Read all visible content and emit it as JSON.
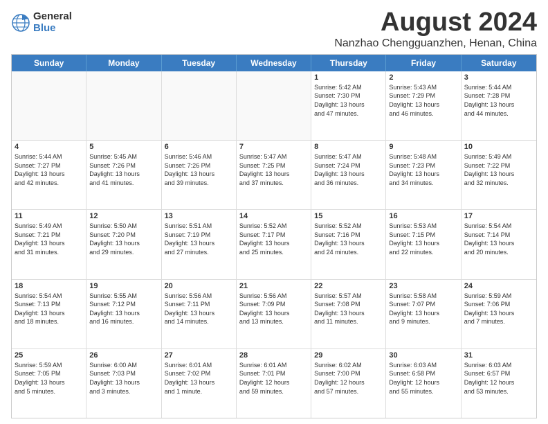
{
  "logo": {
    "general": "General",
    "blue": "Blue"
  },
  "title": "August 2024",
  "location": "Nanzhao Chengguanzhen, Henan, China",
  "headers": [
    "Sunday",
    "Monday",
    "Tuesday",
    "Wednesday",
    "Thursday",
    "Friday",
    "Saturday"
  ],
  "weeks": [
    [
      {
        "day": "",
        "info": "",
        "empty": true
      },
      {
        "day": "",
        "info": "",
        "empty": true
      },
      {
        "day": "",
        "info": "",
        "empty": true
      },
      {
        "day": "",
        "info": "",
        "empty": true
      },
      {
        "day": "1",
        "info": "Sunrise: 5:42 AM\nSunset: 7:30 PM\nDaylight: 13 hours\nand 47 minutes.",
        "empty": false
      },
      {
        "day": "2",
        "info": "Sunrise: 5:43 AM\nSunset: 7:29 PM\nDaylight: 13 hours\nand 46 minutes.",
        "empty": false
      },
      {
        "day": "3",
        "info": "Sunrise: 5:44 AM\nSunset: 7:28 PM\nDaylight: 13 hours\nand 44 minutes.",
        "empty": false
      }
    ],
    [
      {
        "day": "4",
        "info": "Sunrise: 5:44 AM\nSunset: 7:27 PM\nDaylight: 13 hours\nand 42 minutes.",
        "empty": false
      },
      {
        "day": "5",
        "info": "Sunrise: 5:45 AM\nSunset: 7:26 PM\nDaylight: 13 hours\nand 41 minutes.",
        "empty": false
      },
      {
        "day": "6",
        "info": "Sunrise: 5:46 AM\nSunset: 7:26 PM\nDaylight: 13 hours\nand 39 minutes.",
        "empty": false
      },
      {
        "day": "7",
        "info": "Sunrise: 5:47 AM\nSunset: 7:25 PM\nDaylight: 13 hours\nand 37 minutes.",
        "empty": false
      },
      {
        "day": "8",
        "info": "Sunrise: 5:47 AM\nSunset: 7:24 PM\nDaylight: 13 hours\nand 36 minutes.",
        "empty": false
      },
      {
        "day": "9",
        "info": "Sunrise: 5:48 AM\nSunset: 7:23 PM\nDaylight: 13 hours\nand 34 minutes.",
        "empty": false
      },
      {
        "day": "10",
        "info": "Sunrise: 5:49 AM\nSunset: 7:22 PM\nDaylight: 13 hours\nand 32 minutes.",
        "empty": false
      }
    ],
    [
      {
        "day": "11",
        "info": "Sunrise: 5:49 AM\nSunset: 7:21 PM\nDaylight: 13 hours\nand 31 minutes.",
        "empty": false
      },
      {
        "day": "12",
        "info": "Sunrise: 5:50 AM\nSunset: 7:20 PM\nDaylight: 13 hours\nand 29 minutes.",
        "empty": false
      },
      {
        "day": "13",
        "info": "Sunrise: 5:51 AM\nSunset: 7:19 PM\nDaylight: 13 hours\nand 27 minutes.",
        "empty": false
      },
      {
        "day": "14",
        "info": "Sunrise: 5:52 AM\nSunset: 7:17 PM\nDaylight: 13 hours\nand 25 minutes.",
        "empty": false
      },
      {
        "day": "15",
        "info": "Sunrise: 5:52 AM\nSunset: 7:16 PM\nDaylight: 13 hours\nand 24 minutes.",
        "empty": false
      },
      {
        "day": "16",
        "info": "Sunrise: 5:53 AM\nSunset: 7:15 PM\nDaylight: 13 hours\nand 22 minutes.",
        "empty": false
      },
      {
        "day": "17",
        "info": "Sunrise: 5:54 AM\nSunset: 7:14 PM\nDaylight: 13 hours\nand 20 minutes.",
        "empty": false
      }
    ],
    [
      {
        "day": "18",
        "info": "Sunrise: 5:54 AM\nSunset: 7:13 PM\nDaylight: 13 hours\nand 18 minutes.",
        "empty": false
      },
      {
        "day": "19",
        "info": "Sunrise: 5:55 AM\nSunset: 7:12 PM\nDaylight: 13 hours\nand 16 minutes.",
        "empty": false
      },
      {
        "day": "20",
        "info": "Sunrise: 5:56 AM\nSunset: 7:11 PM\nDaylight: 13 hours\nand 14 minutes.",
        "empty": false
      },
      {
        "day": "21",
        "info": "Sunrise: 5:56 AM\nSunset: 7:09 PM\nDaylight: 13 hours\nand 13 minutes.",
        "empty": false
      },
      {
        "day": "22",
        "info": "Sunrise: 5:57 AM\nSunset: 7:08 PM\nDaylight: 13 hours\nand 11 minutes.",
        "empty": false
      },
      {
        "day": "23",
        "info": "Sunrise: 5:58 AM\nSunset: 7:07 PM\nDaylight: 13 hours\nand 9 minutes.",
        "empty": false
      },
      {
        "day": "24",
        "info": "Sunrise: 5:59 AM\nSunset: 7:06 PM\nDaylight: 13 hours\nand 7 minutes.",
        "empty": false
      }
    ],
    [
      {
        "day": "25",
        "info": "Sunrise: 5:59 AM\nSunset: 7:05 PM\nDaylight: 13 hours\nand 5 minutes.",
        "empty": false
      },
      {
        "day": "26",
        "info": "Sunrise: 6:00 AM\nSunset: 7:03 PM\nDaylight: 13 hours\nand 3 minutes.",
        "empty": false
      },
      {
        "day": "27",
        "info": "Sunrise: 6:01 AM\nSunset: 7:02 PM\nDaylight: 13 hours\nand 1 minute.",
        "empty": false
      },
      {
        "day": "28",
        "info": "Sunrise: 6:01 AM\nSunset: 7:01 PM\nDaylight: 12 hours\nand 59 minutes.",
        "empty": false
      },
      {
        "day": "29",
        "info": "Sunrise: 6:02 AM\nSunset: 7:00 PM\nDaylight: 12 hours\nand 57 minutes.",
        "empty": false
      },
      {
        "day": "30",
        "info": "Sunrise: 6:03 AM\nSunset: 6:58 PM\nDaylight: 12 hours\nand 55 minutes.",
        "empty": false
      },
      {
        "day": "31",
        "info": "Sunrise: 6:03 AM\nSunset: 6:57 PM\nDaylight: 12 hours\nand 53 minutes.",
        "empty": false
      }
    ]
  ]
}
